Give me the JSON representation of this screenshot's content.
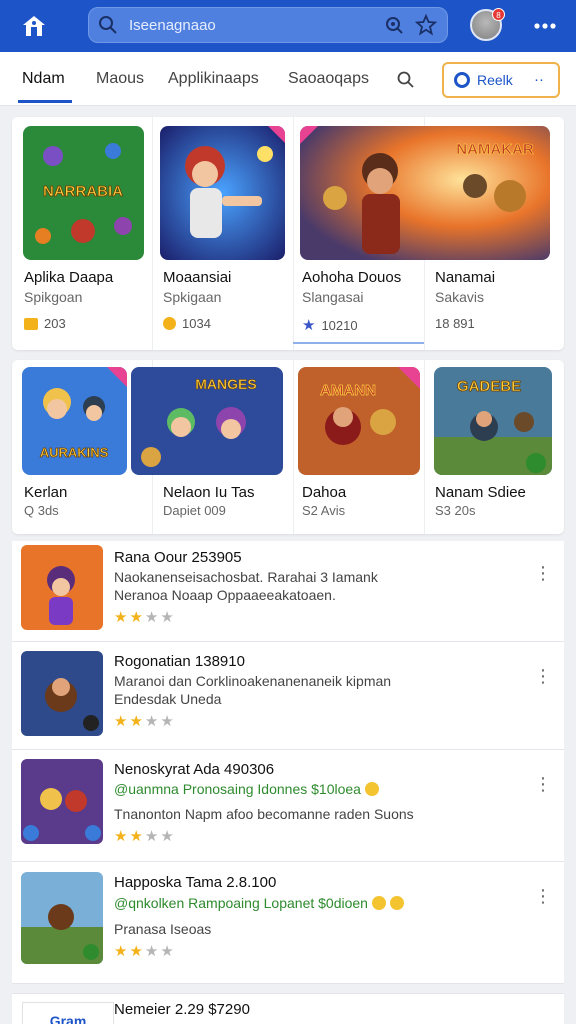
{
  "topbar": {
    "search_text": "Iseenagnaao",
    "avatar_badge": "8"
  },
  "tabs": [
    {
      "label": "Ndam"
    },
    {
      "label": "Maous"
    },
    {
      "label": "Applikinaaps"
    },
    {
      "label": "Saoaoqaps"
    }
  ],
  "tab_button": {
    "label": "Reelk",
    "suffix": "··"
  },
  "grid_row1": [
    {
      "title": "Aplika Daapa",
      "sub": "Spikgoan",
      "meta": "203",
      "thumb_text": "NARRABIA"
    },
    {
      "title": "Moaansiai",
      "sub": "Spkigaan",
      "meta": "1034",
      "thumb_text": ""
    },
    {
      "title": "Aohoha Douos",
      "sub": "Slangasai",
      "meta": "10210",
      "thumb_text": ""
    },
    {
      "title": "Nanamai",
      "sub": "Sakavis",
      "meta": "18 891",
      "thumb_text": "NAMAKAR"
    }
  ],
  "grid_row2": [
    {
      "title": "Kerlan",
      "sub": "Q 3ds",
      "thumb_text": "AURAKINS"
    },
    {
      "title": "Nelaon Iu Tas",
      "sub": "Dapiet 009",
      "thumb_text": "MANGES"
    },
    {
      "title": "Dahoa",
      "sub": "S2 Avis",
      "thumb_text": "AMANN"
    },
    {
      "title": "Nanam Sdiee",
      "sub": "S3 20s",
      "thumb_text": "GADEBE"
    }
  ],
  "list": [
    {
      "title": "Rana Oour 253905",
      "line1": "Naokanenseisachosbat. Rarahai 3 Iamank",
      "line2": "Neranoa Noaap Oppaaeeakatoaen.",
      "line1_green": false,
      "stars": 2
    },
    {
      "title": "Rogonatian 138910",
      "line1": "Maranoi dan Corklinoakenanenaneik kipman",
      "line2": "Endesdak Uneda",
      "line1_green": false,
      "stars": 2
    },
    {
      "title": "Nenoskyrat Ada 490306",
      "line1": "@uanmna Pronosaing Idonnes $10loea",
      "line2": "Tnanonton Napm afoo becomanne raden Suons",
      "line1_green": true,
      "stars": 2
    },
    {
      "title": "Happoska Tama 2.8.100",
      "line1": "@qnkolken Rampoaing Lopanet $0dioen",
      "line2": "Pranasa Iseoas",
      "line1_green": true,
      "stars": 2
    }
  ],
  "bottom": {
    "logo": "Gram",
    "title": "Nemeier 2.29 $7290"
  },
  "colors": {
    "topbar": "#1d55c8",
    "accent_border": "#f0b24b",
    "star": "#f3b21a"
  }
}
